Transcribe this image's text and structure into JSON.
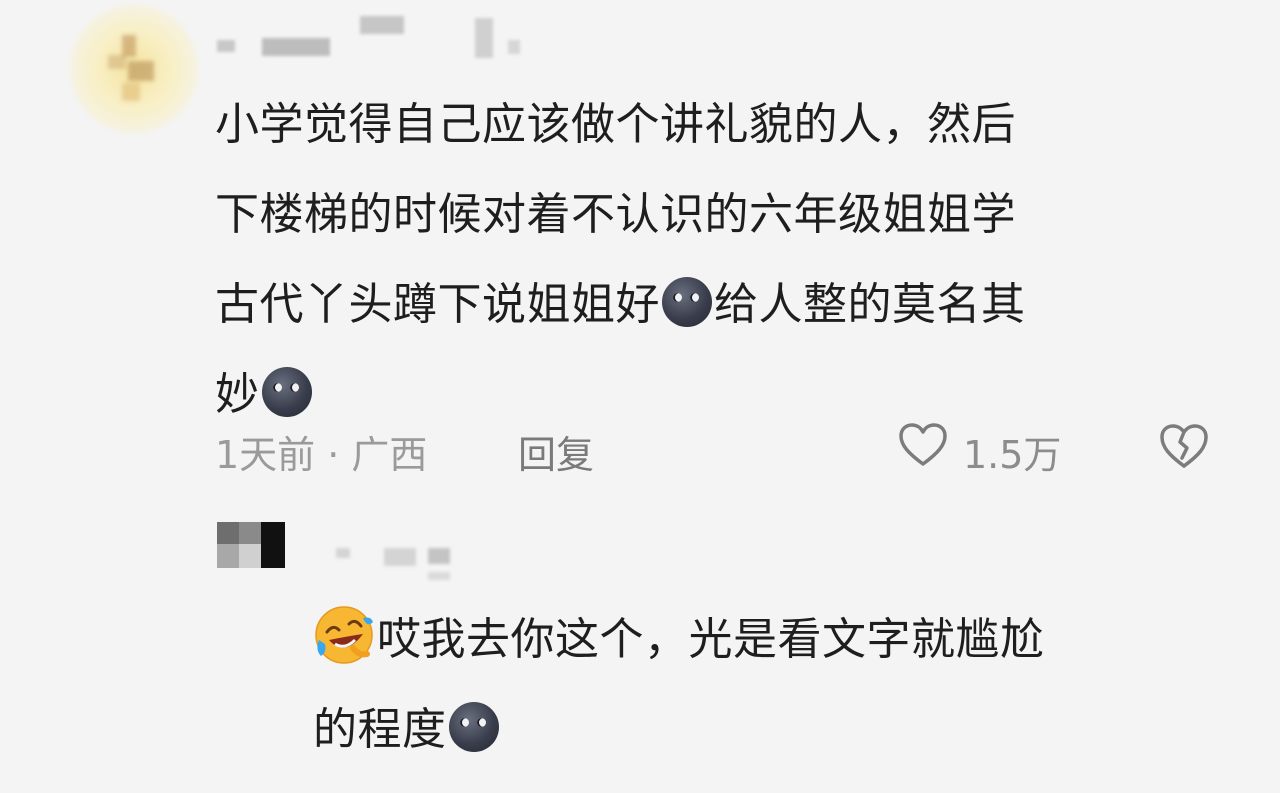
{
  "comment": {
    "lines": [
      "小学觉得自己应该做个讲礼貌的人，然后",
      "下楼梯的时候对着不认识的六年级姐姐学",
      "古代丫头蹲下说姐姐好",
      "给人整的莫名其",
      "妙"
    ],
    "time_location": "1天前 · 广西",
    "reply_label": "回复",
    "like_count": "1.5万",
    "emoji": "dark-face-emoji"
  },
  "reply": {
    "lines": [
      "哎我去你这个，光是看文字就尴尬",
      "的程度"
    ],
    "emoji_leading": "laughing-crying-emoji",
    "emoji_trailing": "dark-face-emoji"
  },
  "colors": {
    "background": "#f4f4f4",
    "text": "#1e1e1e",
    "meta_text": "#9a9a9a",
    "icon_stroke": "#7c7c7c"
  }
}
